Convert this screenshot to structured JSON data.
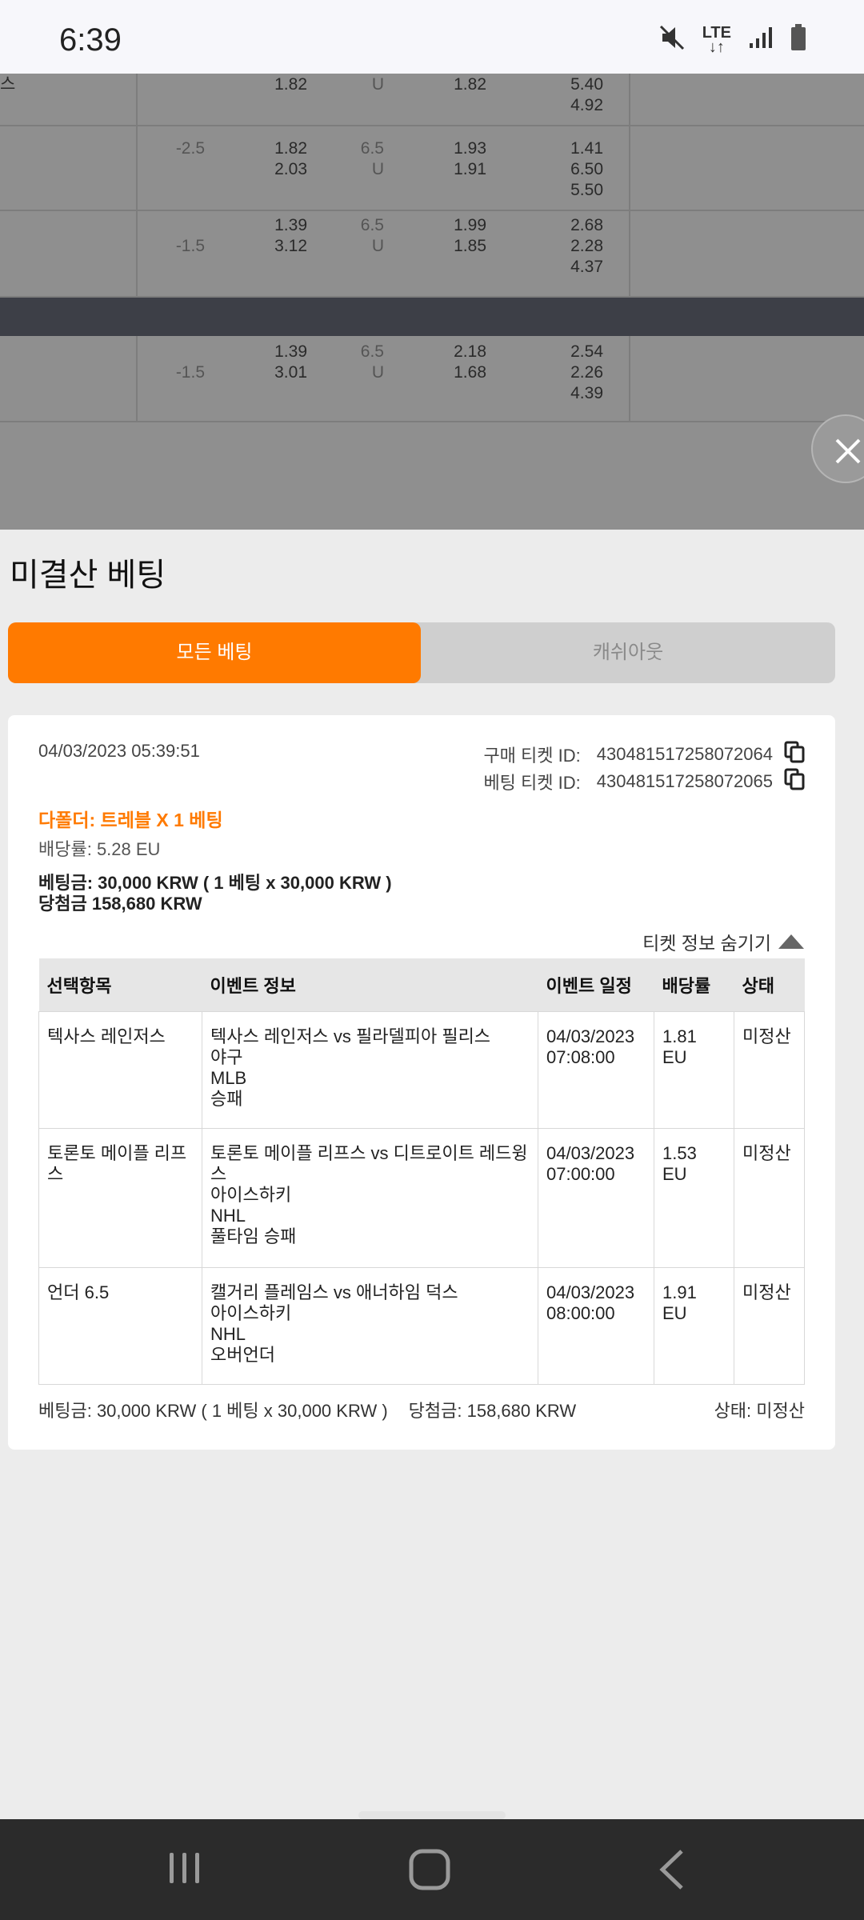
{
  "status_bar": {
    "time": "6:39",
    "lte_label_top": "LTE",
    "lte_label_bottom": "↓↑"
  },
  "background_rows": [
    {
      "col1": "스",
      "handicap": "",
      "odds1": "1.82",
      "total": "U",
      "ou_odds": "1.82",
      "x12": [
        "5.40",
        "4.92"
      ]
    },
    {
      "handicap": "-2.5",
      "odds1": "1.82",
      "odds2": "2.03",
      "total": "6.5",
      "total2": "U",
      "ou_odds": "1.93",
      "ou_odds2": "1.91",
      "x12": [
        "1.41",
        "6.50",
        "5.50"
      ]
    },
    {
      "handicap": "-1.5",
      "odds1": "1.39",
      "odds2": "3.12",
      "total": "6.5",
      "total2": "U",
      "ou_odds": "1.99",
      "ou_odds2": "1.85",
      "x12": [
        "2.68",
        "2.28",
        "4.37"
      ]
    },
    {
      "handicap": "-1.5",
      "odds1": "1.39",
      "odds2": "3.01",
      "total": "6.5",
      "total2": "U",
      "ou_odds": "2.18",
      "ou_odds2": "1.68",
      "x12": [
        "2.54",
        "2.26",
        "4.39"
      ]
    }
  ],
  "sheet": {
    "title": "미결산 베팅",
    "tabs": {
      "all": "모든 베팅",
      "cashout": "캐쉬아웃"
    }
  },
  "ticket": {
    "date": "04/03/2023 05:39:51",
    "purchase_id_label": "구매 티켓 ID:",
    "purchase_id": "430481517258072064",
    "bet_id_label": "베팅 티켓 ID:",
    "bet_id": "430481517258072065",
    "type": "다폴더: 트레블 X 1 베팅",
    "odds": "배당률: 5.28 EU",
    "stake": "베팅금: 30,000 KRW ( 1 베팅 x 30,000 KRW )",
    "win": "당첨금 158,680 KRW",
    "hide_label": "티켓 정보 숨기기",
    "headers": [
      "선택항목",
      "이벤트 정보",
      "이벤트 일정",
      "배당률",
      "상태"
    ],
    "rows": [
      {
        "selection": "텍사스 레인저스",
        "event": [
          "텍사스 레인저스 vs 필라델피아 필리스",
          "야구",
          "MLB",
          "승패"
        ],
        "schedule": [
          "04/03/2023",
          "07:08:00"
        ],
        "odds": "1.81 EU",
        "status": "미정산"
      },
      {
        "selection": "토론토 메이플 리프스",
        "event": [
          "토론토 메이플 리프스 vs 디트로이트 레드윙스",
          "아이스하키",
          "NHL",
          "풀타임 승패"
        ],
        "schedule": [
          "04/03/2023",
          "07:00:00"
        ],
        "odds": "1.53 EU",
        "status": "미정산"
      },
      {
        "selection": "언더 6.5",
        "event": [
          "캘거리 플레임스 vs 애너하임 덕스",
          "아이스하키",
          "NHL",
          "오버언더"
        ],
        "schedule": [
          "04/03/2023",
          "08:00:00"
        ],
        "odds": "1.91 EU",
        "status": "미정산"
      }
    ],
    "footer_stake": "베팅금: 30,000 KRW ( 1 베팅 x 30,000 KRW )",
    "footer_win": "당첨금: 158,680 KRW",
    "footer_status": "상태: 미정산"
  }
}
